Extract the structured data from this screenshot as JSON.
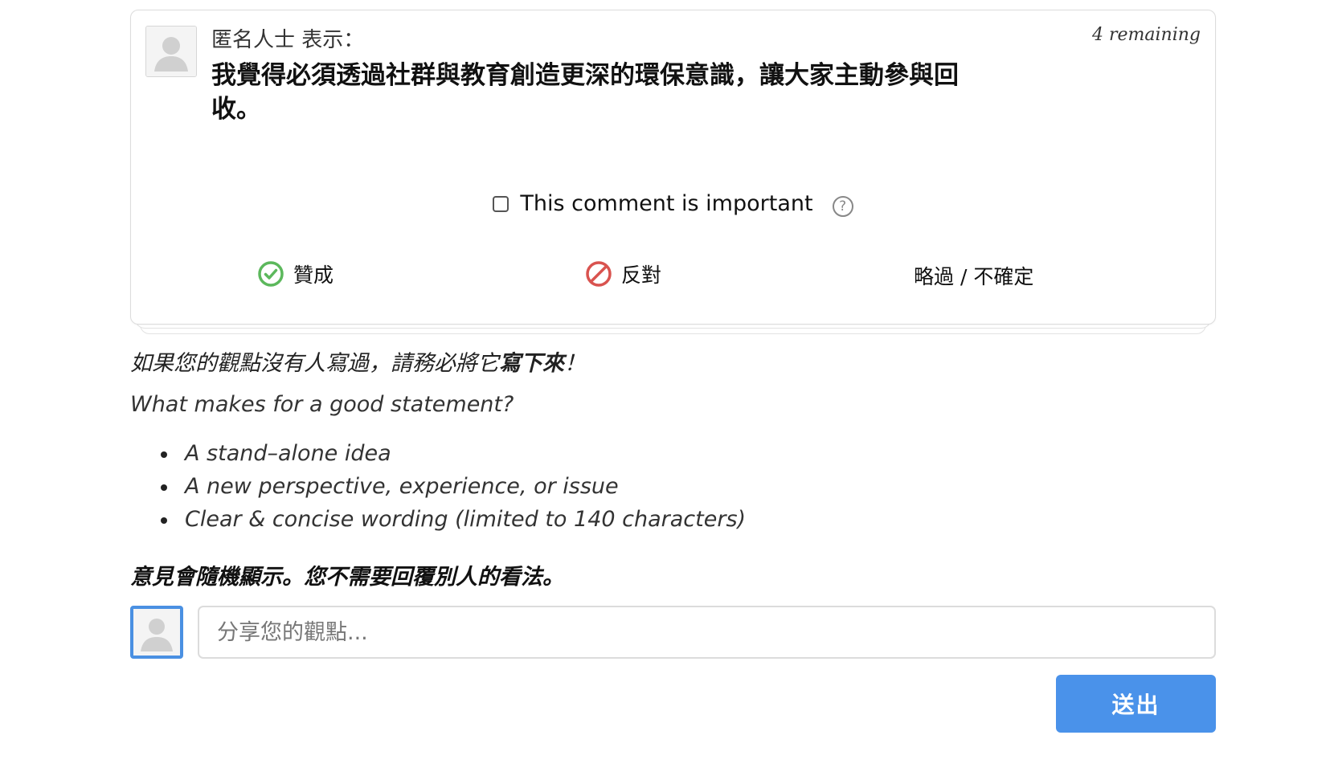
{
  "card": {
    "author_line": "匿名人士 表示：",
    "remaining": "4 remaining",
    "statement": "我覺得必須透過社群與教育創造更深的環保意識，讓大家主動參與回收。",
    "important_label": "This comment is important",
    "help_icon_text": "?",
    "votes": {
      "agree": "贊成",
      "disagree": "反對",
      "pass": "略過 / 不確定"
    }
  },
  "guidance": {
    "prompt_prefix": "如果您的觀點沒有人寫過，請務必將它",
    "prompt_bold": "寫下來",
    "prompt_suffix": "！",
    "question": "What makes for a good statement?",
    "tips": [
      "A stand–alone idea",
      "A new perspective, experience, or issue",
      "Clear & concise wording (limited to 140 characters)"
    ],
    "note": "意見會隨機顯示。您不需要回覆別人的看法。"
  },
  "composer": {
    "placeholder": "分享您的觀點...",
    "value": "",
    "submit_label": "送出"
  },
  "colors": {
    "agree": "#5cb85c",
    "disagree": "#d9534f",
    "accent": "#4a92ea"
  },
  "icons": {
    "avatar": "default-avatar-icon",
    "agree": "check-circle-icon",
    "disagree": "prohibit-icon",
    "help": "question-circle-icon"
  }
}
